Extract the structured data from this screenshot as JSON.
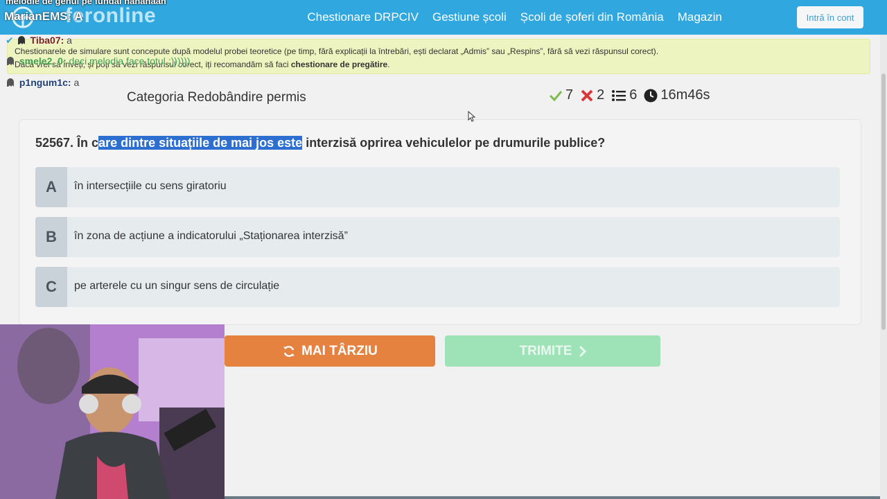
{
  "overlay": {
    "stream_title": "melodie de genul pe fundal hahahaah",
    "streamer": "MarianEMS: A"
  },
  "nav": {
    "logo_text": "feronline",
    "links": [
      "Chestionare DRPCIV",
      "Gestiune școli",
      "Școli de șoferi din România",
      "Magazin"
    ],
    "login": "Intră în cont"
  },
  "notice": {
    "line1": "Chestionarele de simulare sunt concepute după modelul probei teoretice (pe timp, fără explicații la întrebări, ești declarat „Admis” sau „Respins”, fără să vezi răspunsul corect).",
    "line2_a": "Dacă vrei să înveți, și poți să vezi răspunsul corect, iți recomandăm să faci ",
    "line2_b": "chestionare de pregătire",
    "line2_c": "."
  },
  "chat": [
    {
      "nick": "Tiba07:",
      "msg": "a"
    },
    {
      "nick": "smele2_0:",
      "msg": "deci melodia face totul :))))))"
    },
    {
      "nick": "p1ngum1c:",
      "msg": "a"
    }
  ],
  "category": "Categoria Redobândire permis",
  "stats": {
    "correct": "7",
    "wrong": "2",
    "remaining": "6",
    "time": "16m46s"
  },
  "question": {
    "prefix": "52567. În c",
    "highlight": "are dintre situațiile de mai jos este",
    "suffix": " interzisă oprirea vehiculelor pe drumurile publice?"
  },
  "answers": [
    {
      "letter": "A",
      "text": "în intersecțiile cu sens giratoriu"
    },
    {
      "letter": "B",
      "text": "în zona de acțiune a indicatorului „Staționarea interzisă”"
    },
    {
      "letter": "C",
      "text": "pe arterele cu un singur sens de circulație"
    }
  ],
  "buttons": {
    "later": "MAI TÂRZIU",
    "send": "TRIMITE"
  },
  "colors": {
    "navbar": "#30a8df",
    "notice_bg": "#eef4bf",
    "later_btn": "#e6823f",
    "send_btn": "#9ee2b8",
    "highlight": "#2d6fd0"
  }
}
